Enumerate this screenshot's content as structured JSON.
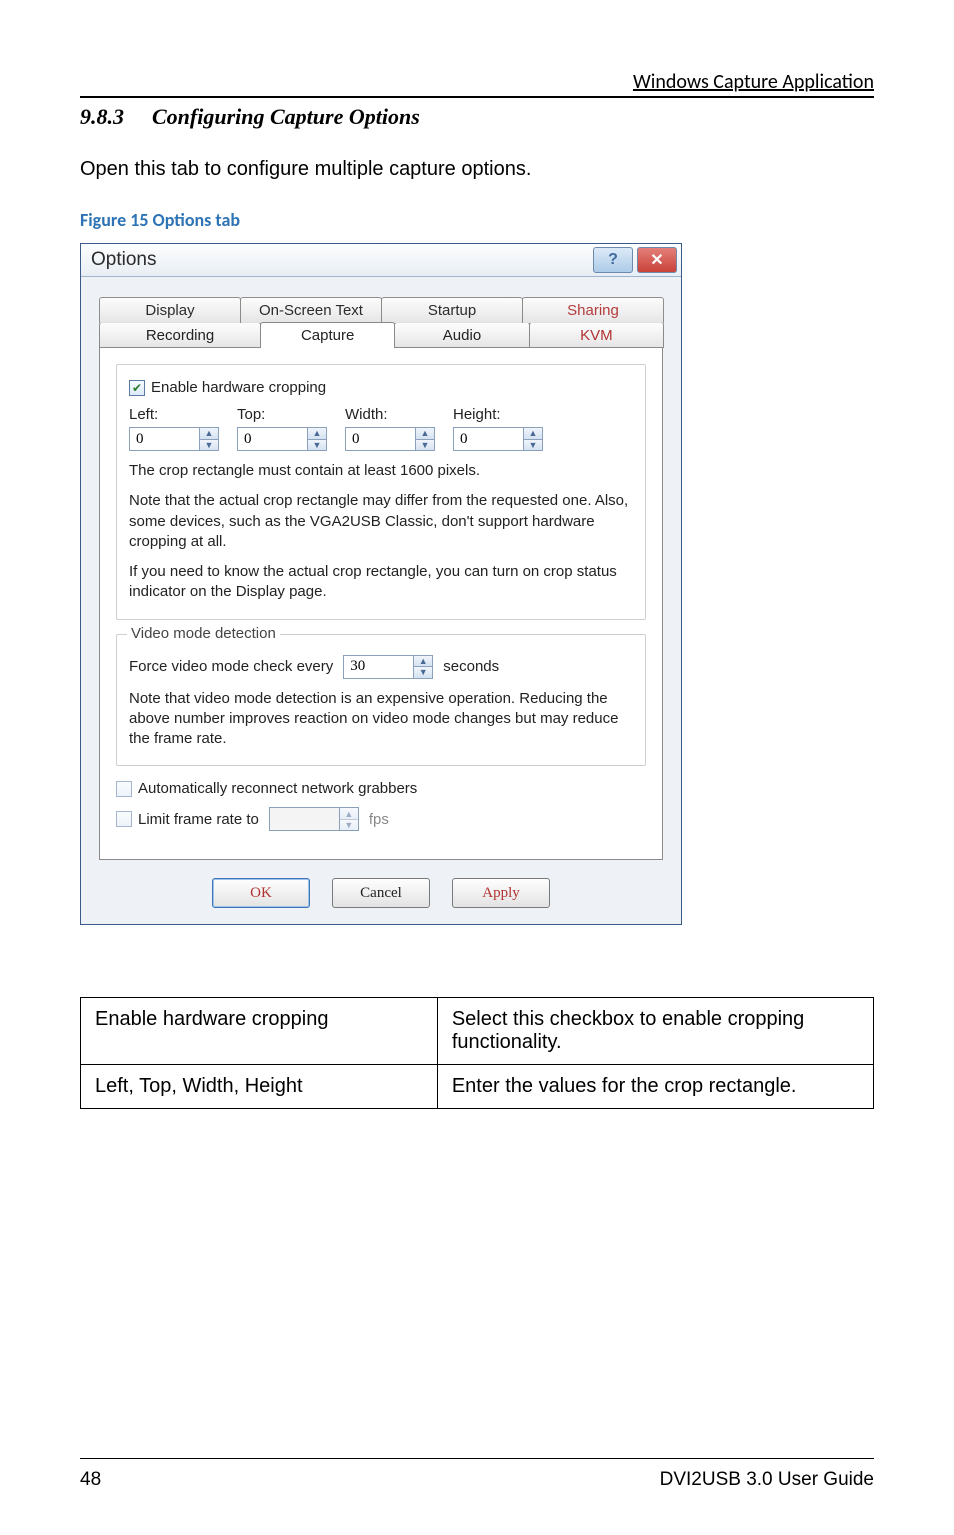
{
  "header": {
    "running": "Windows Capture Application"
  },
  "section": {
    "num": "9.8.3",
    "title": "Configuring Capture Options"
  },
  "intro": "Open this tab to configure multiple capture options.",
  "figure": {
    "caption": "Figure 15 Options tab"
  },
  "dialog": {
    "title": "Options",
    "help_glyph": "?",
    "close_glyph": "✕",
    "tabs_back": [
      "Display",
      "On-Screen Text",
      "Startup",
      "Sharing"
    ],
    "tabs_front": [
      "Recording",
      "Capture",
      "Audio",
      "KVM"
    ],
    "cropping": {
      "checkbox_label": "Enable hardware cropping",
      "checked_glyph": "✔",
      "labels": {
        "left": "Left:",
        "top": "Top:",
        "width": "Width:",
        "height": "Height:"
      },
      "values": {
        "left": "0",
        "top": "0",
        "width": "0",
        "height": "0"
      },
      "note1": "The crop rectangle must contain at least 1600 pixels.",
      "note2": "Note that the actual crop rectangle may differ from the requested one. Also, some devices, such as the VGA2USB Classic, don't support hardware cropping at all.",
      "note3": "If you need to know the actual crop rectangle, you can turn on crop status indicator on the Display page."
    },
    "video": {
      "legend": "Video mode detection",
      "force_label": "Force video mode check every",
      "force_value": "30",
      "force_unit": "seconds",
      "note": "Note that video mode detection is an expensive operation. Reducing the above number improves reaction on video mode changes but may reduce the frame rate."
    },
    "reconnect_label": "Automatically reconnect network grabbers",
    "limit": {
      "label": "Limit frame rate to",
      "value": "",
      "unit": "fps"
    },
    "buttons": {
      "ok": "OK",
      "cancel": "Cancel",
      "apply": "Apply"
    },
    "spin": {
      "up": "▲",
      "down": "▼"
    }
  },
  "table": {
    "r1c1": "Enable hardware cropping",
    "r1c2": "Select this checkbox to enable cropping functionality.",
    "r2c1": "Left, Top, Width, Height",
    "r2c2": "Enter the values for the crop rectangle."
  },
  "footer": {
    "page": "48",
    "doc": "DVI2USB 3.0  User Guide"
  }
}
